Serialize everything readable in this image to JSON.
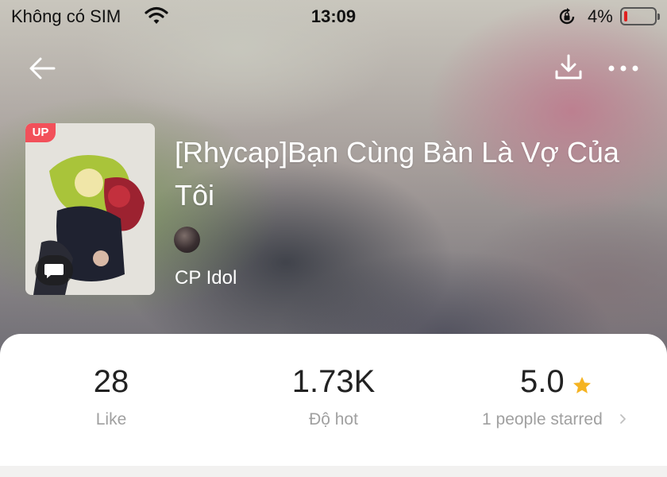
{
  "status_bar": {
    "carrier": "Không có SIM",
    "time": "13:09",
    "battery": "4%"
  },
  "nav": {
    "back_icon": "arrow-left-icon",
    "download_icon": "download-icon",
    "more_icon": "more-dots-icon"
  },
  "book": {
    "badge": "UP",
    "title": "[Rhycap]Bạn Cùng Bàn Là Vợ Của Tôi",
    "category": "CP Idol"
  },
  "stats": {
    "like_value": "28",
    "like_label": "Like",
    "hot_value": "1.73K",
    "hot_label": "Độ hot",
    "rating_value": "5.0",
    "rating_label": "1 people starred"
  },
  "colors": {
    "badge": "#f2505a",
    "star": "#f5b321",
    "battery_low": "#e02020"
  }
}
